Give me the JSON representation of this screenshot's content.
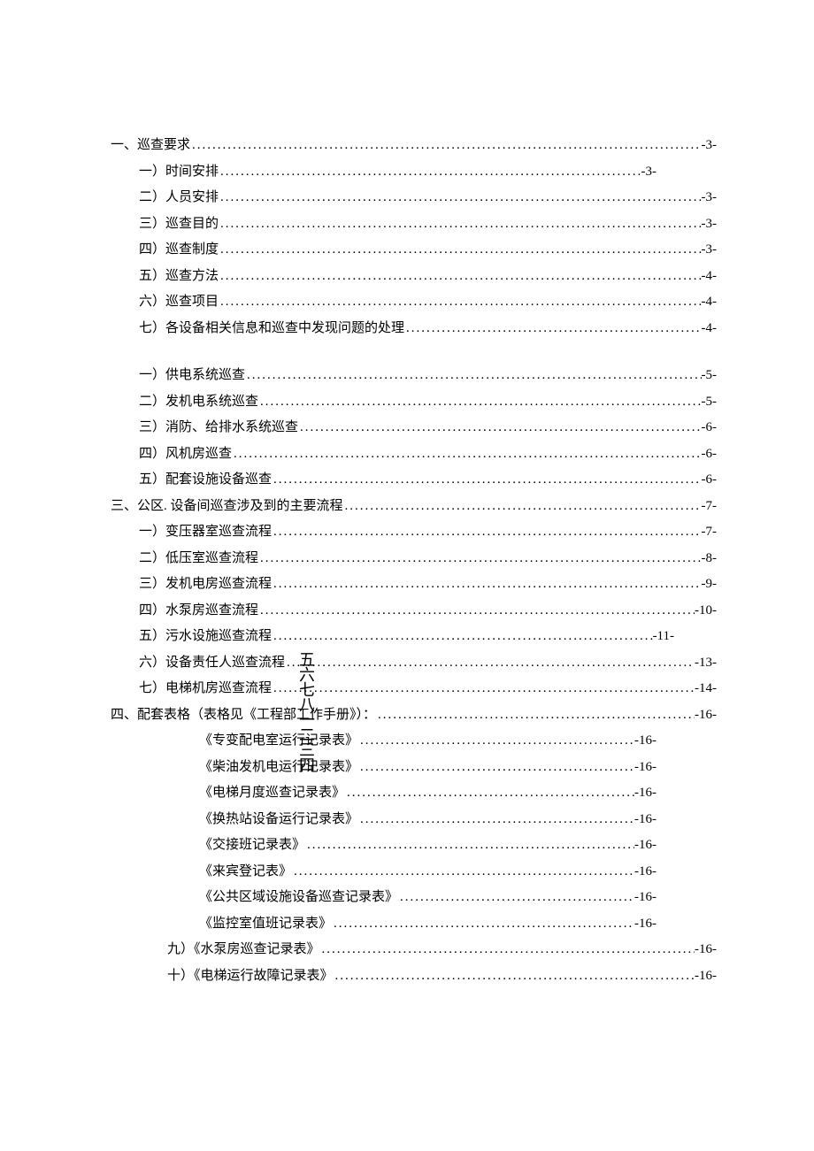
{
  "toc": [
    {
      "indent": 0,
      "short": 4,
      "label": "一、巡查要求",
      "page": "-3-"
    },
    {
      "indent": 1,
      "short": 1,
      "label": "一）时间安排",
      "page": "-3-"
    },
    {
      "indent": 1,
      "short": 4,
      "label": "二）人员安排",
      "page": "-3-"
    },
    {
      "indent": 1,
      "short": 4,
      "label": "三）巡查目的",
      "page": "-3-"
    },
    {
      "indent": 1,
      "short": 4,
      "label": "四）巡查制度",
      "page": "-3-"
    },
    {
      "indent": 1,
      "short": 4,
      "label": "五）巡查方法",
      "page": "-4-"
    },
    {
      "indent": 1,
      "short": 4,
      "label": "六）巡查项目",
      "page": "-4-"
    },
    {
      "indent": 1,
      "short": 4,
      "label": "七）各设备相关信息和巡查中发现问题的处理",
      "page": "-4-"
    },
    {
      "blank": true
    },
    {
      "indent": 1,
      "short": 4,
      "label": "一）供电系统巡查",
      "page": "-5-"
    },
    {
      "indent": 1,
      "short": 4,
      "label": "二）发机电系统巡查",
      "page": "-5-"
    },
    {
      "indent": 1,
      "short": 4,
      "label": "三）消防、给排水系统巡查",
      "page": "-6-"
    },
    {
      "indent": 1,
      "short": 4,
      "label": "四）风机房巡查",
      "page": "-6-"
    },
    {
      "indent": 1,
      "short": 4,
      "label": "五）配套设施设备巡查",
      "page": "-6-"
    },
    {
      "indent": 0,
      "short": 4,
      "label": "三、公区. 设备间巡查涉及到的主要流程",
      "page": "-7-"
    },
    {
      "indent": 1,
      "short": 4,
      "label": "一）变压器室巡查流程",
      "page": "-7-"
    },
    {
      "indent": 1,
      "short": 4,
      "label": "二）低压室巡查流程",
      "page": "-8-"
    },
    {
      "indent": 1,
      "short": 4,
      "label": "三）发机电房巡查流程",
      "page": "-9-"
    },
    {
      "indent": 1,
      "short": 4,
      "label": "四）水泵房巡查流程",
      "page": "-10-"
    },
    {
      "indent": 1,
      "short": 3,
      "label": "五）污水设施巡查流程",
      "page": "-11-"
    },
    {
      "indent": 1,
      "short": 4,
      "label": "六）设备责任人巡查流程",
      "page": "-13-"
    },
    {
      "indent": 1,
      "short": 4,
      "label": "七）电梯机房巡查流程",
      "page": "-14-"
    },
    {
      "indent": 0,
      "short": 4,
      "label": "四、配套表格（表格见《工程部工作手册》）：",
      "page": "-16-"
    },
    {
      "indent": "2b",
      "short": 1,
      "label": "《专变配电室运行记录表》",
      "page": "-16-"
    },
    {
      "indent": "2b",
      "short": 1,
      "label": "《柴油发机电运行记录表》",
      "page": "-16-"
    },
    {
      "indent": "2b",
      "short": 1,
      "label": "《电梯月度巡查记录表》",
      "page": "-16-"
    },
    {
      "indent": "2b",
      "short": 1,
      "label": "《换热站设备运行记录表》",
      "page": "-16-"
    },
    {
      "indent": "2b",
      "short": 1,
      "label": "《交接班记录表》",
      "page": "-16-"
    },
    {
      "indent": "2b",
      "short": 1,
      "label": "《来宾登记表》",
      "page": "-16-"
    },
    {
      "indent": "2b",
      "short": 1,
      "label": "《公共区域设施设备巡查记录表》",
      "page": "-16-"
    },
    {
      "indent": "2b",
      "short": 1,
      "label": "《监控室值班记录表》",
      "page": "-16-"
    },
    {
      "indent": "2a",
      "short": 4,
      "label": "九）《水泵房巡查记录表》",
      "page": "-16-"
    },
    {
      "indent": "2a",
      "short": 4,
      "label": "十）《电梯运行故障记录表》",
      "page": "-16-"
    }
  ],
  "vertical_markers": "五六七八一二三四"
}
